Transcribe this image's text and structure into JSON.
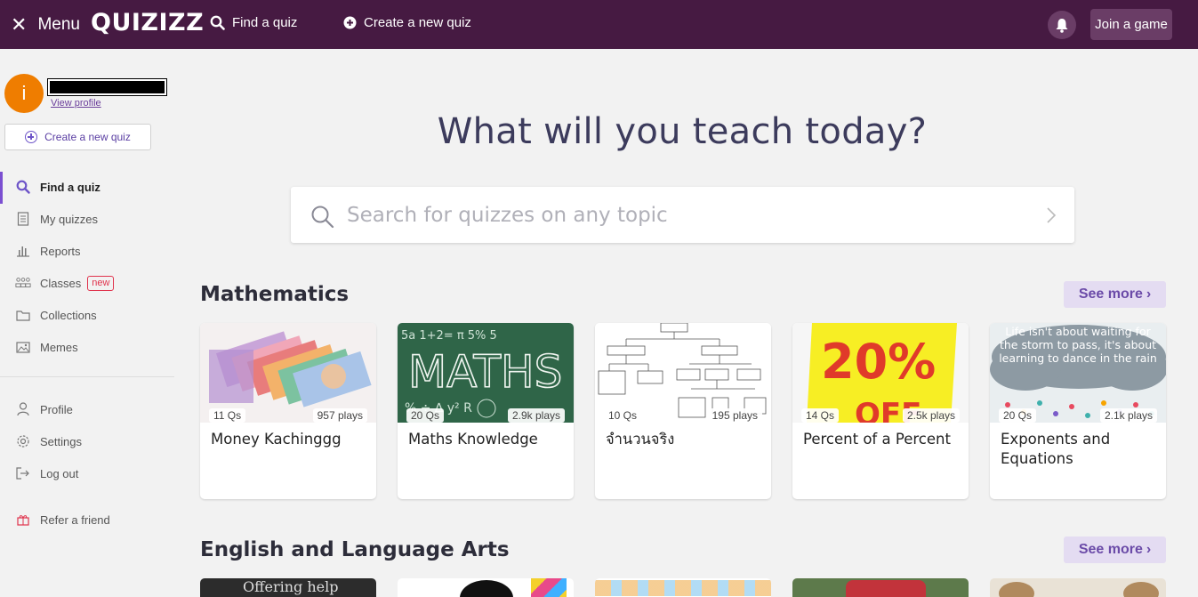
{
  "topbar": {
    "menu_label": "Menu",
    "logo": "QUIZIZZ",
    "find_label": "Find a quiz",
    "create_label": "Create a new quiz",
    "join_label": "Join a game"
  },
  "sidebar": {
    "avatar_initial": "i",
    "view_profile": "View profile",
    "create_label": "Create a new quiz",
    "items": [
      {
        "label": "Find a quiz",
        "icon": "search-icon"
      },
      {
        "label": "My quizzes",
        "icon": "document-icon"
      },
      {
        "label": "Reports",
        "icon": "bar-chart-icon"
      },
      {
        "label": "Classes",
        "icon": "classes-icon",
        "badge": "new"
      },
      {
        "label": "Collections",
        "icon": "folder-icon"
      },
      {
        "label": "Memes",
        "icon": "image-icon"
      }
    ],
    "bottom_items": [
      {
        "label": "Profile",
        "icon": "user-icon"
      },
      {
        "label": "Settings",
        "icon": "gear-icon"
      },
      {
        "label": "Log out",
        "icon": "logout-icon"
      },
      {
        "label": "Refer a friend",
        "icon": "gift-icon"
      }
    ]
  },
  "main": {
    "headline": "What will you teach today?",
    "search_placeholder": "Search for quizzes on any topic",
    "sections": [
      {
        "title": "Mathematics",
        "see_more": "See more",
        "cards": [
          {
            "title": "Money Kachinggg",
            "questions": "11 Qs",
            "plays": "957 plays"
          },
          {
            "title": "Maths Knowledge",
            "questions": "20 Qs",
            "plays": "2.9k plays"
          },
          {
            "title": "จำนวนจริง",
            "questions": "10 Qs",
            "plays": "195 plays"
          },
          {
            "title": "Percent of a Percent",
            "questions": "14 Qs",
            "plays": "2.5k plays"
          },
          {
            "title": "Exponents and Equations",
            "questions": "20 Qs",
            "plays": "2.1k plays"
          }
        ]
      },
      {
        "title": "English and Language Arts",
        "see_more": "See more"
      }
    ],
    "thumb_text": {
      "maths": "MATHS",
      "percent": "20%",
      "off": "OFF",
      "quote": "Life isn't about waiting for the storm to pass, it's about learning to dance in the rain",
      "offering": "Offering help"
    }
  },
  "colors": {
    "topbar": "#461a42",
    "accent": "#7b4fd1",
    "see_more_bg": "#e4dcf2",
    "avatar": "#ef7d00"
  }
}
